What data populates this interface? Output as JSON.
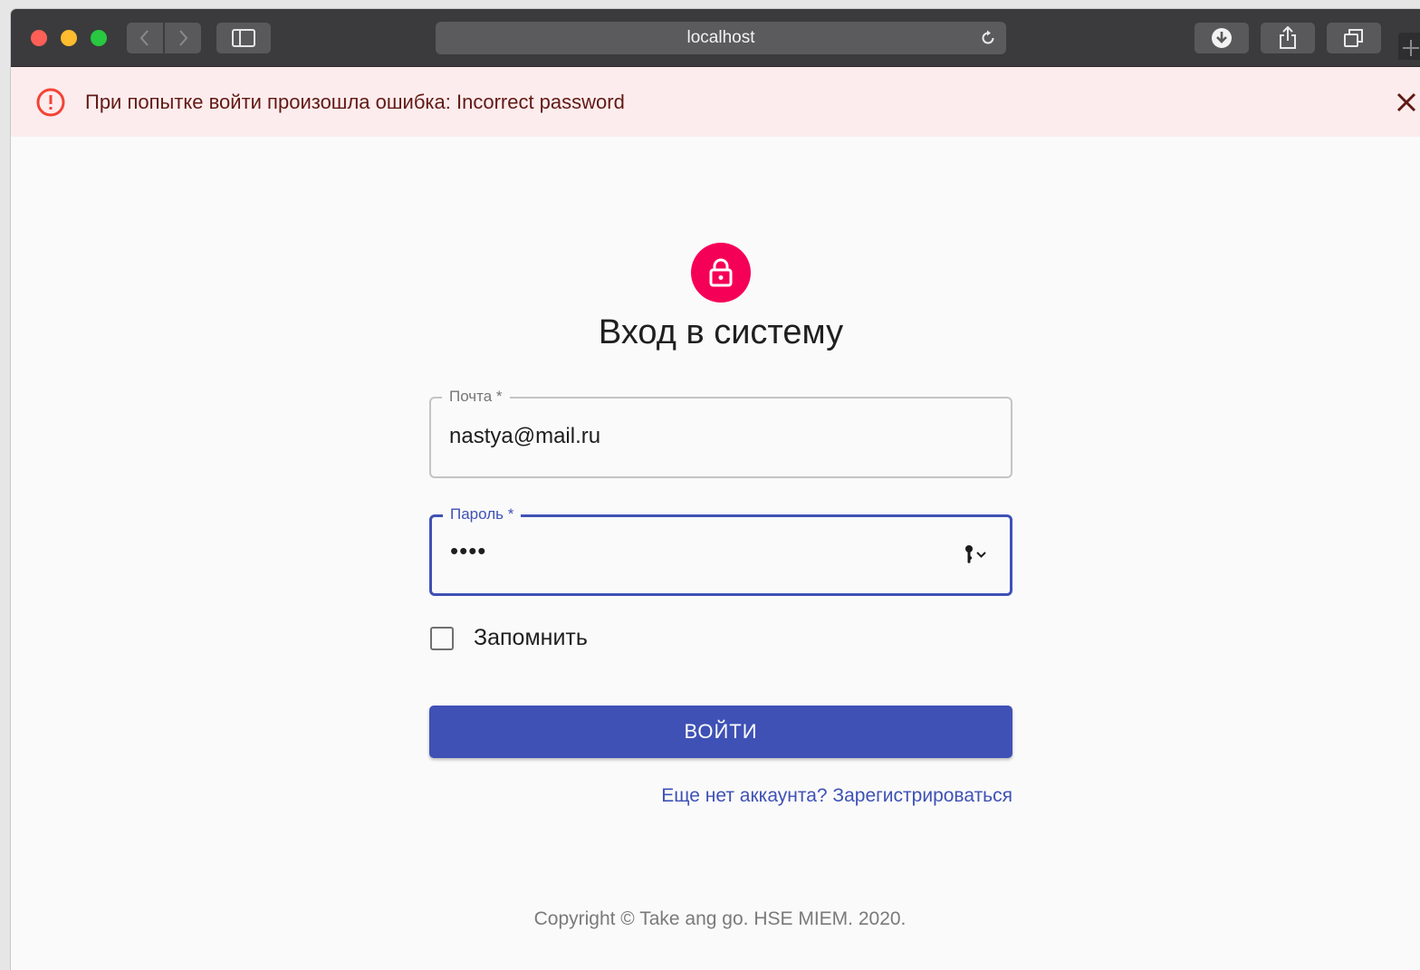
{
  "browser": {
    "url": "localhost"
  },
  "alert": {
    "message": "При попытке войти произошла ошибка: Incorrect password"
  },
  "login": {
    "title": "Вход в систему",
    "email_label": "Почта *",
    "email_value": "nastya@mail.ru",
    "password_label": "Пароль *",
    "password_value": "••••",
    "remember_label": "Запомнить",
    "submit_label": "ВОЙТИ",
    "signup_link": "Еще нет аккаунта? Зарегистрироваться"
  },
  "footer": {
    "copyright": "Copyright © Take ang go. HSE MIEM. 2020."
  },
  "colors": {
    "primary": "#3f51b5",
    "avatar": "#f50057",
    "alert_bg": "#fdeced",
    "alert_icon": "#f44336"
  }
}
